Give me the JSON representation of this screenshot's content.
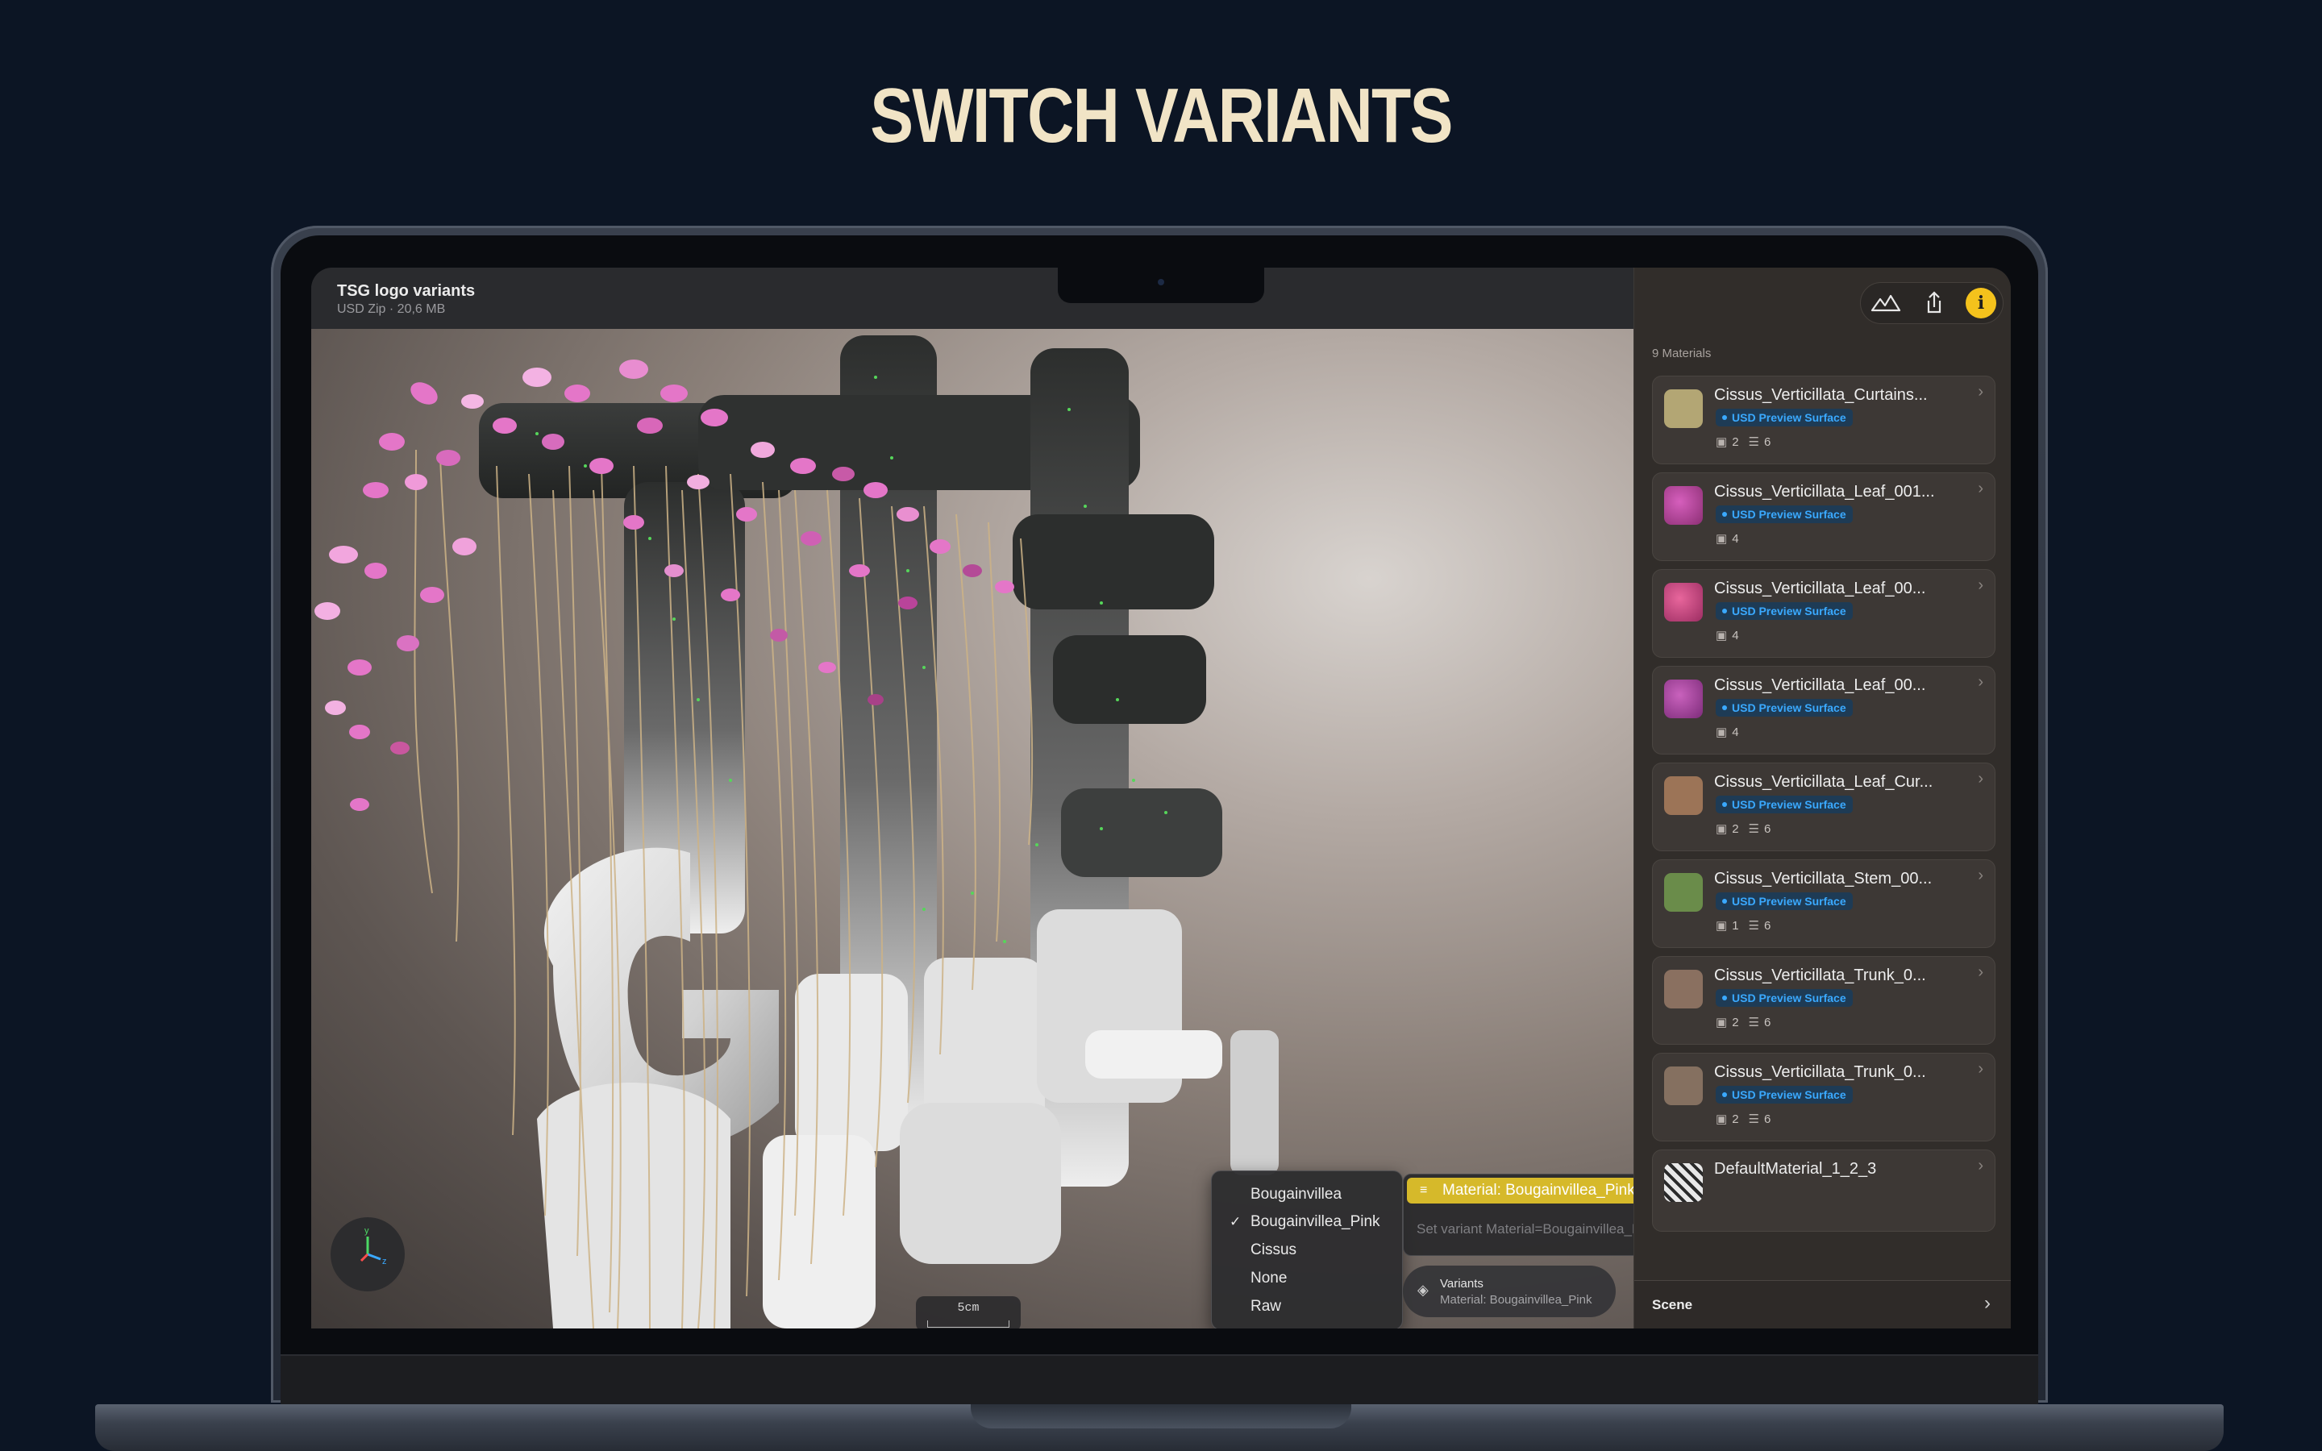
{
  "headline": "SWITCH VARIANTS",
  "document": {
    "title": "TSG logo variants",
    "subtitle": "USD Zip · 20,6 MB"
  },
  "toolbar": {
    "environment_icon": "mountains-icon",
    "share_icon": "share-icon",
    "info_icon": "info-icon",
    "info_glyph": "i"
  },
  "sidebar": {
    "materials_count": "9 Materials",
    "materials": [
      {
        "name": "Cissus_Verticillata_Curtains...",
        "tag": "USD Preview Surface",
        "images": "2",
        "params": "6",
        "color": "#b3a674"
      },
      {
        "name": "Cissus_Verticillata_Leaf_001...",
        "tag": "USD Preview Surface",
        "images": "4",
        "params": "",
        "color": "#b43f9b"
      },
      {
        "name": "Cissus_Verticillata_Leaf_00...",
        "tag": "USD Preview Surface",
        "images": "4",
        "params": "",
        "color": "#c9457f"
      },
      {
        "name": "Cissus_Verticillata_Leaf_00...",
        "tag": "USD Preview Surface",
        "images": "4",
        "params": "",
        "color": "#a9459c"
      },
      {
        "name": "Cissus_Verticillata_Leaf_Cur...",
        "tag": "USD Preview Surface",
        "images": "2",
        "params": "6",
        "color": "#9c7457"
      },
      {
        "name": "Cissus_Verticillata_Stem_00...",
        "tag": "USD Preview Surface",
        "images": "1",
        "params": "6",
        "color": "#6a8c4a"
      },
      {
        "name": "Cissus_Verticillata_Trunk_0...",
        "tag": "USD Preview Surface",
        "images": "2",
        "params": "6",
        "color": "#8a7060"
      },
      {
        "name": "Cissus_Verticillata_Trunk_0...",
        "tag": "USD Preview Surface",
        "images": "2",
        "params": "6",
        "color": "#857060"
      },
      {
        "name": "DefaultMaterial_1_2_3",
        "tag": "",
        "images": "",
        "params": "",
        "color": "#e8e8e8"
      }
    ],
    "scene_label": "Scene"
  },
  "viewport": {
    "scale_label": "5cm",
    "axis_labels": {
      "y": "y",
      "z": "z"
    }
  },
  "variant_menu": {
    "options": [
      "Bougainvillea",
      "Bougainvillea_Pink",
      "Cissus",
      "None",
      "Raw"
    ],
    "selected": "Bougainvillea_Pink",
    "highlighted": "Material: Bougainvillea_Pink",
    "hint": "Set variant Material=Bougainvillea_Pink on /Root staged.",
    "pill_title": "Variants",
    "pill_subtitle": "Material: Bougainvillea_Pink"
  },
  "colors": {
    "accent": "#f4c21c",
    "highlight": "#d6b92a",
    "tag": "#3aa9ff",
    "background": "#0c1524",
    "headline": "#f1e4c6"
  }
}
